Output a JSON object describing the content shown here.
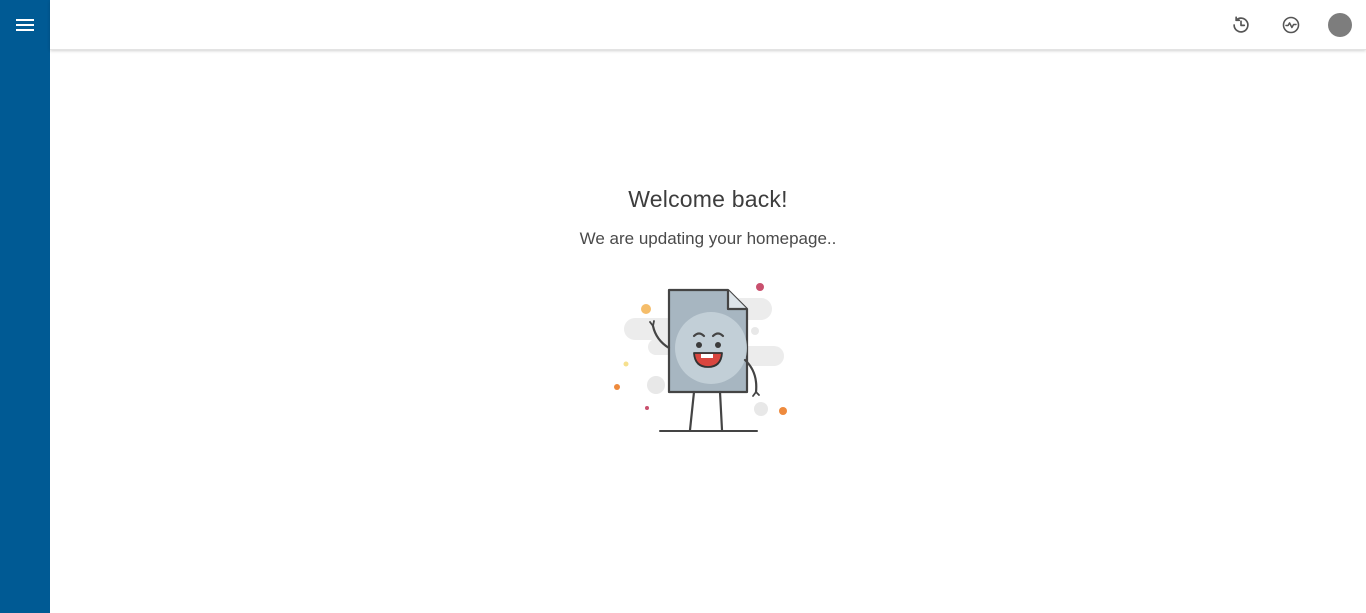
{
  "sidebar": {
    "menu_icon": "hamburger-menu-icon",
    "color": "#005a94"
  },
  "topbar": {
    "icons": [
      "history-icon",
      "activity-icon",
      "avatar"
    ],
    "avatar_color": "#7d7d7d"
  },
  "main": {
    "title": "Welcome back!",
    "subtitle": "We are updating your homepage..",
    "illustration": "document-mascot-illustration"
  }
}
